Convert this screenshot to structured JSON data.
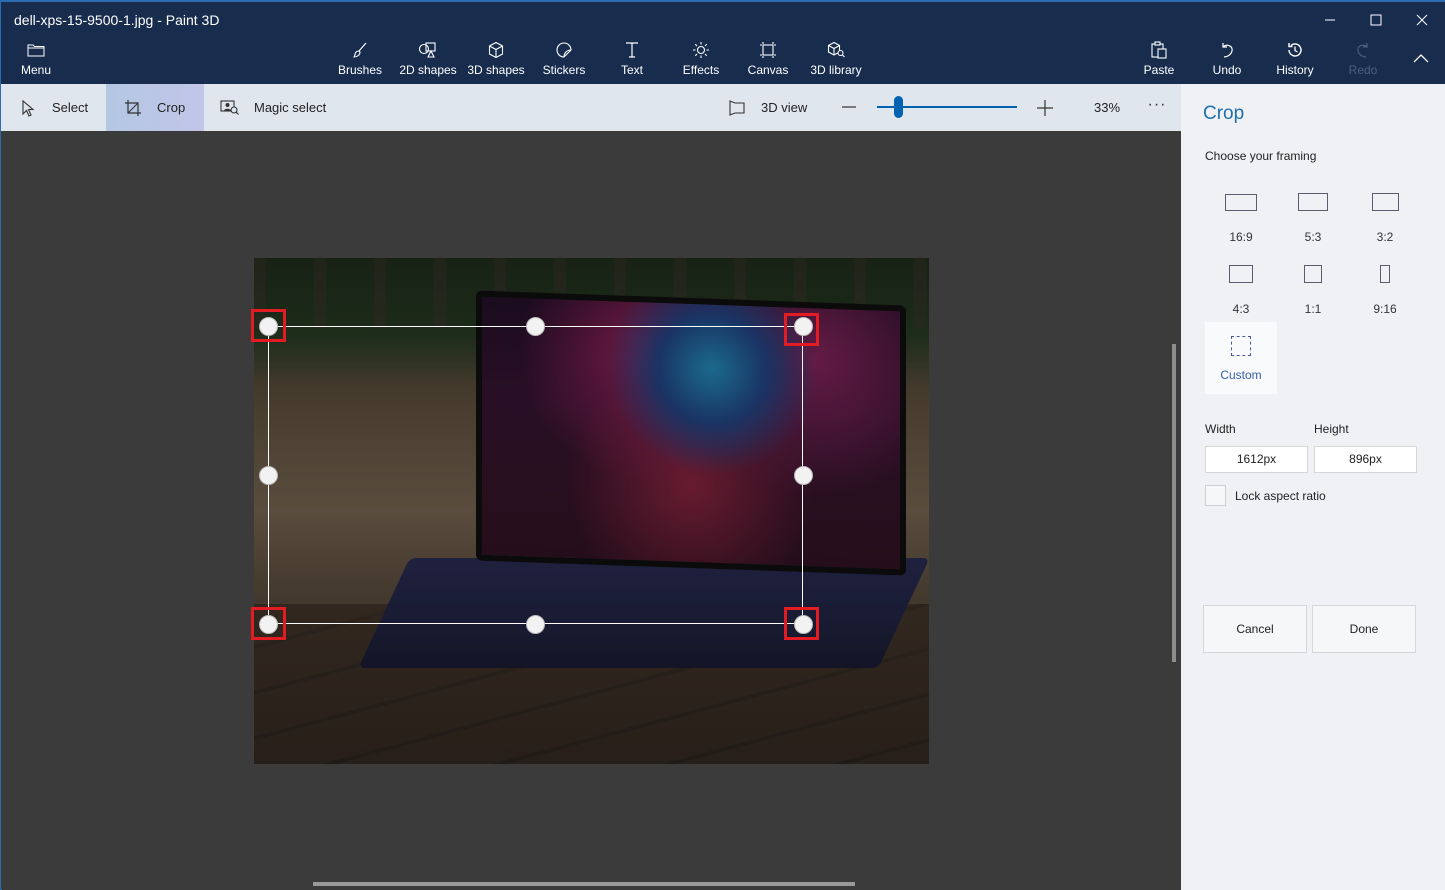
{
  "window": {
    "title": "dell-xps-15-9500-1.jpg - Paint 3D",
    "controls": [
      "minimize",
      "maximize",
      "close"
    ]
  },
  "ribbon": {
    "menu": {
      "label": "Menu",
      "icon": "folder-icon"
    },
    "tools": [
      {
        "label": "Brushes",
        "icon": "brush-icon"
      },
      {
        "label": "2D shapes",
        "icon": "2d-shapes-icon"
      },
      {
        "label": "3D shapes",
        "icon": "3d-cube-icon"
      },
      {
        "label": "Stickers",
        "icon": "sticker-icon"
      },
      {
        "label": "Text",
        "icon": "text-icon"
      },
      {
        "label": "Effects",
        "icon": "sun-icon"
      },
      {
        "label": "Canvas",
        "icon": "canvas-icon"
      },
      {
        "label": "3D library",
        "icon": "3d-library-icon"
      }
    ],
    "actions": [
      {
        "label": "Paste",
        "icon": "paste-icon",
        "enabled": true
      },
      {
        "label": "Undo",
        "icon": "undo-icon",
        "enabled": true
      },
      {
        "label": "History",
        "icon": "history-icon",
        "enabled": true
      },
      {
        "label": "Redo",
        "icon": "redo-icon",
        "enabled": false
      }
    ],
    "collapse_icon": "chevron-up-icon"
  },
  "subtoolbar": {
    "select": "Select",
    "crop": "Crop",
    "magic_select": "Magic select",
    "view_3d": "3D view",
    "zoom_percent": "33%",
    "zoom_slider_fraction": 0.15,
    "more": "···"
  },
  "panel": {
    "title": "Crop",
    "subtitle": "Choose your framing",
    "framings": [
      {
        "label": "16:9",
        "selected": false
      },
      {
        "label": "5:3",
        "selected": false
      },
      {
        "label": "3:2",
        "selected": false
      },
      {
        "label": "4:3",
        "selected": false
      },
      {
        "label": "1:1",
        "selected": false
      },
      {
        "label": "9:16",
        "selected": false
      },
      {
        "label": "Custom",
        "selected": true
      }
    ],
    "width_label": "Width",
    "height_label": "Height",
    "width_value": "1612px",
    "height_value": "896px",
    "lock_aspect_label": "Lock aspect ratio",
    "lock_aspect_checked": false,
    "cancel_label": "Cancel",
    "done_label": "Done"
  },
  "colors": {
    "ribbon_bg": "#182c4e",
    "accent": "#0063b1",
    "panel_title": "#1f6fae",
    "highlight": "#e31b23"
  }
}
